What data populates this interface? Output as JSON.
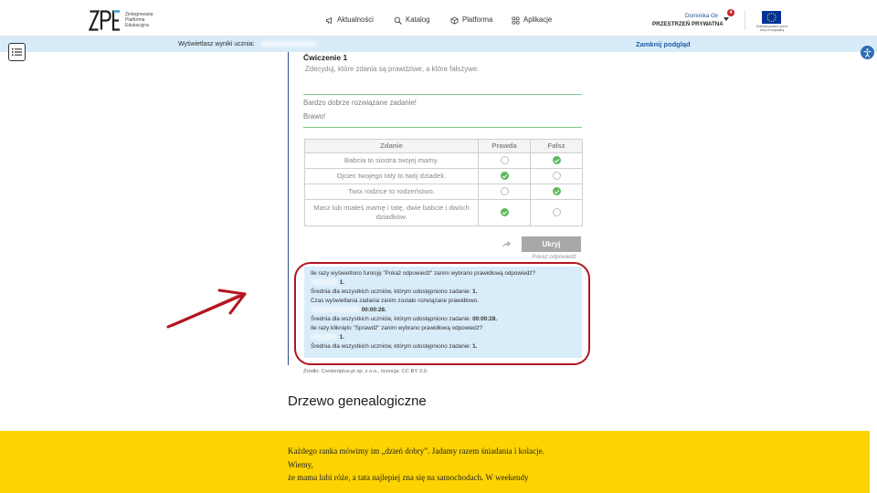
{
  "colors": {
    "accent": "#1d5fa8",
    "success": "#5cb85c",
    "annotation": "#b3141f",
    "highlight": "#fdd401",
    "preview_bg": "#d8ebf8"
  },
  "header": {
    "logo": "ZPE",
    "logo_subtitle": [
      "Zintegrowana",
      "Platforma",
      "Edukacyjna"
    ],
    "nav": [
      {
        "label": "Aktualności",
        "icon": "megaphone-icon"
      },
      {
        "label": "Katalog",
        "icon": "search-icon"
      },
      {
        "label": "Platforma",
        "icon": "cube-icon"
      },
      {
        "label": "Aplikacje",
        "icon": "grid-icon"
      }
    ],
    "user": {
      "name": "Dominika Gir",
      "notifications": "4",
      "space": "PRZESTRZEŃ PRYWATNA"
    },
    "eu_caption": [
      "Dofinansowane przez",
      "Unię Europejską"
    ]
  },
  "sidebar_toggle_icon": "list-icon",
  "accessibility_icon": "accessibility-icon",
  "preview_bar": {
    "label": "Wyświetlasz wyniki ucznia:",
    "close_label": "Zamknij podgląd"
  },
  "exercise": {
    "title": "Ćwiczenie 1",
    "instruction": "Zdecyduj, które zdania są prawdziwe, a które fałszywe.",
    "feedback_title": "Bardzo dobrze rozwiązane zadanie!",
    "feedback_text": "Brawo!",
    "table": {
      "columns": [
        "Zdanie",
        "Prawda",
        "Fałsz"
      ],
      "rows": [
        {
          "sentence": "Babcia to siostra twojej mamy.",
          "prawda": false,
          "falsz": true
        },
        {
          "sentence": "Ojciec twojego taty to twój dziadek.",
          "prawda": true,
          "falsz": false
        },
        {
          "sentence": "Twoi rodzice to rodzeństwo.",
          "prawda": false,
          "falsz": true
        },
        {
          "sentence": "Masz lub miałeś mamę i tatę, dwie babcie i dwóch dziadków.",
          "prawda": true,
          "falsz": false
        }
      ]
    },
    "share_icon": "share-icon",
    "hide_button": "Ukryj",
    "show_answer_link": "Pokaż odpowiedź",
    "stats": {
      "show_answer_question": "Ile razy wyświetlono funkcję \"Pokaż odpowiedź\" zanim wybrano prawidłową odpowiedź?",
      "show_answer_student": "1.",
      "average_label": "Średnia dla wszystkich uczniów, którym udostępniono zadanie:",
      "show_answer_average": "1.",
      "time_question": "Czas wyświetlania zadania zanim zostało rozwiązane prawidłowo.",
      "time_student": "00:00:28.",
      "time_average": "00:00:28.",
      "check_question": "Ile razy kliknięto \"Sprawdź\" zanim wybrano prawidłową odpowiedź?",
      "check_student": "1.",
      "check_average": "1."
    },
    "source": "Źródło: Contentplus.pl sp. z o.o., licencja: CC BY 3.0."
  },
  "section": {
    "title": "Drzewo genealogiczne",
    "lines": [
      "Każdego ranka mówimy im „dzień dobry”. Jadamy razem śniadania i kolacje.",
      "Wiemy,",
      "że mama lubi róże, a tata najlepiej zna się na samochodach. W weekendy"
    ]
  }
}
